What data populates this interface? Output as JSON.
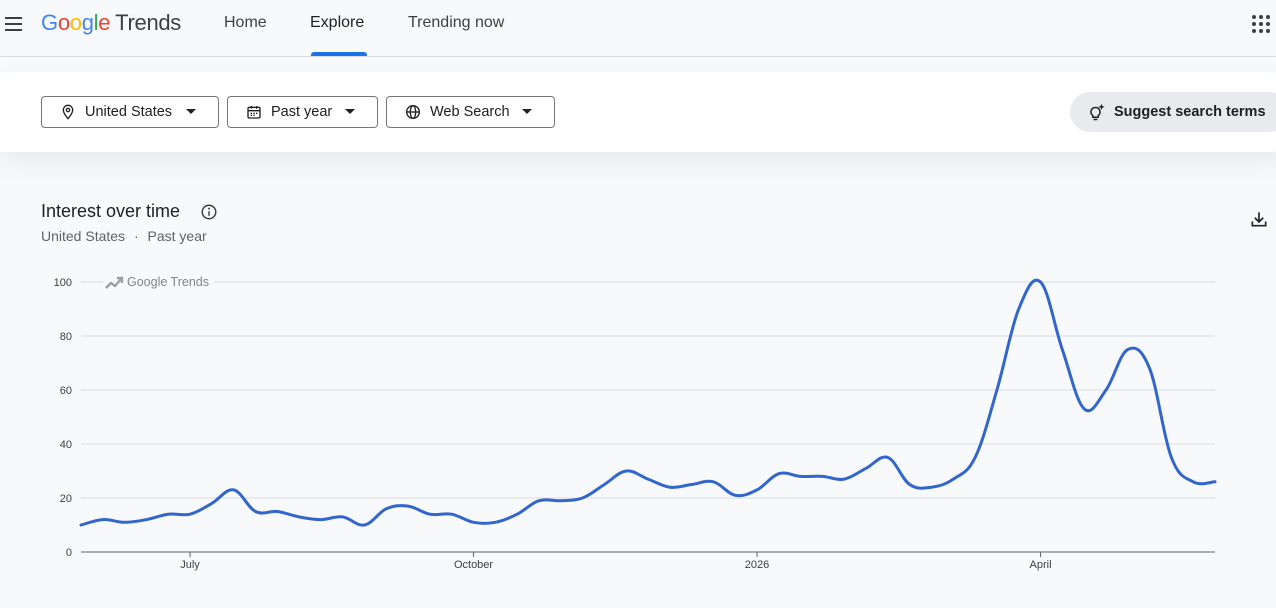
{
  "header": {
    "logo": {
      "letters": [
        "G",
        "o",
        "o",
        "g",
        "l",
        "e"
      ],
      "word": "Trends"
    },
    "tabs": [
      {
        "label": "Home"
      },
      {
        "label": "Explore"
      },
      {
        "label": "Trending now"
      }
    ],
    "active_tab": "Explore"
  },
  "filters": {
    "location": "United States",
    "time_range": "Past year",
    "property": "Web Search",
    "suggest_label": "Suggest search terms"
  },
  "chart_section": {
    "title": "Interest over time",
    "subtitle_location": "United States",
    "subtitle_separator": "·",
    "subtitle_range": "Past year"
  },
  "colors": {
    "line": "#3366cc",
    "accent": "#1a73e8",
    "grid": "#dadce0"
  },
  "chart_data": {
    "type": "line",
    "watermark": "Google Trends",
    "ylim": [
      0,
      100
    ],
    "y_ticks": [
      0,
      20,
      40,
      60,
      80,
      100
    ],
    "x_ticks": [
      {
        "label": "July",
        "week": 5
      },
      {
        "label": "October",
        "week": 18
      },
      {
        "label": "2026",
        "week": 31
      },
      {
        "label": "April",
        "week": 44
      }
    ],
    "grid": true,
    "series": [
      {
        "values": [
          10,
          12,
          11,
          12,
          14,
          14,
          18,
          23,
          15,
          15,
          13,
          12,
          13,
          10,
          16,
          17,
          14,
          14,
          11,
          11,
          14,
          19,
          19,
          20,
          25,
          30,
          27,
          24,
          25,
          26,
          21,
          23,
          29,
          28,
          28,
          27,
          31,
          35,
          25,
          24,
          27,
          35,
          60,
          90,
          100,
          75,
          53,
          60,
          75,
          68,
          35,
          26,
          26
        ]
      }
    ]
  }
}
